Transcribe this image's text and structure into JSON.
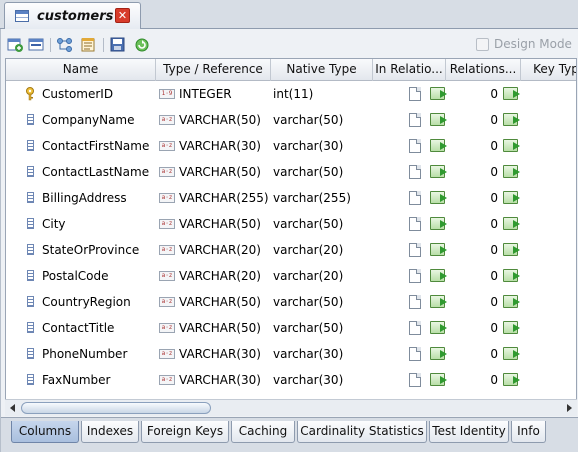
{
  "tab": {
    "title": "customers",
    "close_label": "✕"
  },
  "toolbar": {
    "design_mode_label": "Design Mode"
  },
  "columns": {
    "headers": [
      "Name",
      "Type / Reference",
      "Native Type",
      "In Relatio...",
      "Relations...",
      "Key Typ"
    ],
    "rows": [
      {
        "name": "CustomerID",
        "type": "INTEGER",
        "native": "int(11)",
        "relations": "0",
        "icon": "key-icon",
        "type_icon": "integer-type-icon"
      },
      {
        "name": "CompanyName",
        "type": "VARCHAR(50)",
        "native": "varchar(50)",
        "relations": "0",
        "icon": "column-icon",
        "type_icon": "string-type-icon"
      },
      {
        "name": "ContactFirstName",
        "type": "VARCHAR(30)",
        "native": "varchar(30)",
        "relations": "0",
        "icon": "column-icon",
        "type_icon": "string-type-icon"
      },
      {
        "name": "ContactLastName",
        "type": "VARCHAR(50)",
        "native": "varchar(50)",
        "relations": "0",
        "icon": "column-icon",
        "type_icon": "string-type-icon"
      },
      {
        "name": "BillingAddress",
        "type": "VARCHAR(255)",
        "native": "varchar(255)",
        "relations": "0",
        "icon": "column-icon",
        "type_icon": "string-type-icon"
      },
      {
        "name": "City",
        "type": "VARCHAR(50)",
        "native": "varchar(50)",
        "relations": "0",
        "icon": "column-icon",
        "type_icon": "string-type-icon"
      },
      {
        "name": "StateOrProvince",
        "type": "VARCHAR(20)",
        "native": "varchar(20)",
        "relations": "0",
        "icon": "column-icon",
        "type_icon": "string-type-icon"
      },
      {
        "name": "PostalCode",
        "type": "VARCHAR(20)",
        "native": "varchar(20)",
        "relations": "0",
        "icon": "column-icon",
        "type_icon": "string-type-icon"
      },
      {
        "name": "CountryRegion",
        "type": "VARCHAR(50)",
        "native": "varchar(50)",
        "relations": "0",
        "icon": "column-icon",
        "type_icon": "string-type-icon"
      },
      {
        "name": "ContactTitle",
        "type": "VARCHAR(50)",
        "native": "varchar(50)",
        "relations": "0",
        "icon": "column-icon",
        "type_icon": "string-type-icon"
      },
      {
        "name": "PhoneNumber",
        "type": "VARCHAR(30)",
        "native": "varchar(30)",
        "relations": "0",
        "icon": "column-icon",
        "type_icon": "string-type-icon"
      },
      {
        "name": "FaxNumber",
        "type": "VARCHAR(30)",
        "native": "varchar(30)",
        "relations": "0",
        "icon": "column-icon",
        "type_icon": "string-type-icon"
      }
    ]
  },
  "bottom_tabs": [
    "Columns",
    "Indexes",
    "Foreign Keys",
    "Caching",
    "Cardinality Statistics",
    "Test Identity",
    "Info"
  ],
  "active_bottom_tab": "Columns",
  "colors": {
    "accent": "#a9bfde",
    "close": "#d83b2b",
    "panel": "#eef1f5"
  }
}
